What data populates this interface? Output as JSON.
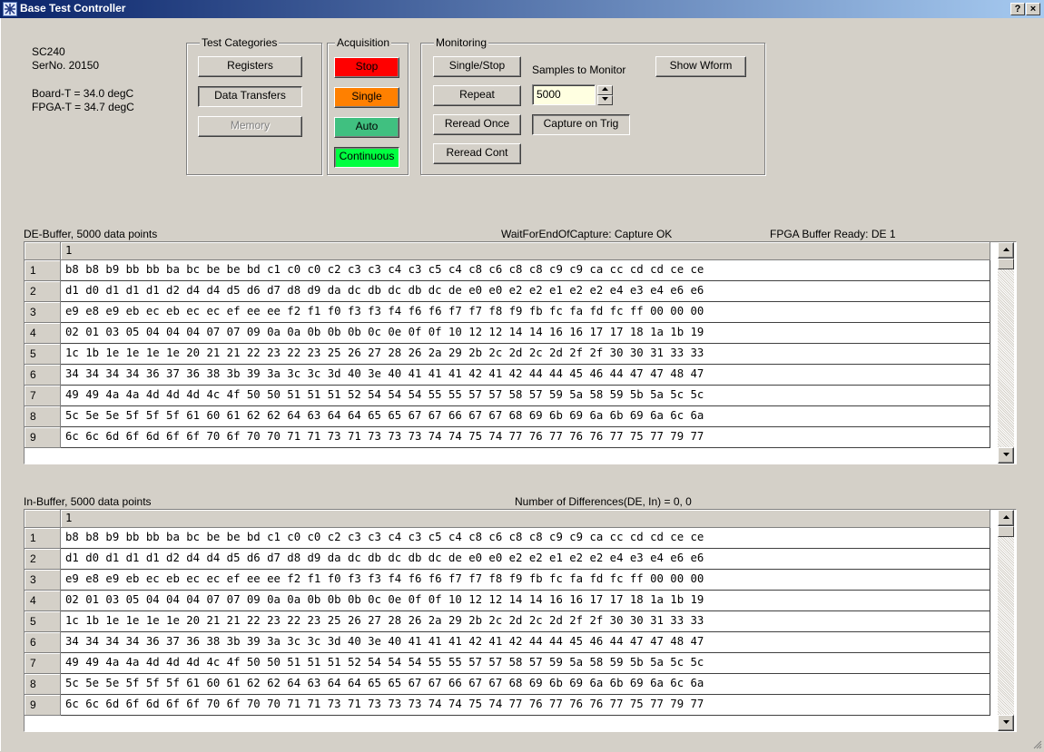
{
  "window": {
    "title": "Base Test Controller",
    "help_label": "?",
    "close_label": "×"
  },
  "device": {
    "model": "SC240",
    "serial": "SerNo. 20150",
    "board_temp": "Board-T = 34.0 degC",
    "fpga_temp": "FPGA-T = 34.7 degC"
  },
  "test_categories": {
    "label": "Test Categories",
    "registers": "Registers",
    "data_transfers": "Data Transfers",
    "memory": "Memory"
  },
  "acquisition": {
    "label": "Acquisition",
    "stop": "Stop",
    "single": "Single",
    "auto": "Auto",
    "continuous": "Continuous",
    "colors": {
      "stop": "#ff0000",
      "single": "#ff8000",
      "auto": "#40c080",
      "continuous": "#00ff40"
    }
  },
  "monitoring": {
    "label": "Monitoring",
    "single_stop": "Single/Stop",
    "repeat": "Repeat",
    "reread_once": "Reread Once",
    "reread_cont": "Reread Cont",
    "samples_label": "Samples to Monitor",
    "samples_value": "5000",
    "capture_on_trig": "Capture on Trig",
    "show_wform": "Show Wform"
  },
  "de_buffer": {
    "title": "DE-Buffer,  5000 data points",
    "status": "WaitForEndOfCapture: Capture OK",
    "fpga_status": "FPGA Buffer Ready:  DE 1",
    "col_header": "1",
    "rows": [
      {
        "n": "1",
        "v": "b8 b8 b9 bb bb ba bc be be bd c1 c0 c0 c2 c3 c3 c4 c3 c5 c4 c8 c6 c8 c8 c9 c9 ca cc cd cd ce ce"
      },
      {
        "n": "2",
        "v": "d1 d0 d1 d1 d1 d2 d4 d4 d5 d6 d7 d8 d9 da dc db dc db dc de e0 e0 e2 e2 e1 e2 e2 e4 e3 e4 e6 e6"
      },
      {
        "n": "3",
        "v": "e9 e8 e9 eb ec eb ec ec ef ee ee f2 f1 f0 f3 f3 f4 f6 f6 f7 f7 f8 f9 fb fc fa fd fc ff 00 00 00"
      },
      {
        "n": "4",
        "v": "02 01 03 05 04 04 04 07 07 09 0a 0a 0b 0b 0b 0c 0e 0f 0f 10 12 12 14 14 16 16 17 17 18 1a 1b 19"
      },
      {
        "n": "5",
        "v": "1c 1b 1e 1e 1e 1e 20 21 21 22 23 22 23 25 26 27 28 26 2a 29 2b 2c 2d 2c 2d 2f 2f 30 30 31 33 33"
      },
      {
        "n": "6",
        "v": "34 34 34 34 36 37 36 38 3b 39 3a 3c 3c 3d 40 3e 40 41 41 41 42 41 42 44 44 45 46 44 47 47 48 47"
      },
      {
        "n": "7",
        "v": "49 49 4a 4a 4d 4d 4d 4c 4f 50 50 51 51 51 52 54 54 54 55 55 57 57 58 57 59 5a 58 59 5b 5a 5c 5c"
      },
      {
        "n": "8",
        "v": "5c 5e 5e 5f 5f 5f 61 60 61 62 62 64 63 64 64 65 65 67 67 66 67 67 68 69 6b 69 6a 6b 69 6a 6c 6a"
      },
      {
        "n": "9",
        "v": "6c 6c 6d 6f 6d 6f 6f 70 6f 70 70 71 71 73 71 73 73 73 74 74 75 74 77 76 77 76 76 77 75 77 79 77"
      }
    ]
  },
  "in_buffer": {
    "title": "In-Buffer,  5000 data points",
    "status": "Number of Differences(DE, In) = 0, 0",
    "col_header": "1",
    "rows": [
      {
        "n": "1",
        "v": "b8 b8 b9 bb bb ba bc be be bd c1 c0 c0 c2 c3 c3 c4 c3 c5 c4 c8 c6 c8 c8 c9 c9 ca cc cd cd ce ce"
      },
      {
        "n": "2",
        "v": "d1 d0 d1 d1 d1 d2 d4 d4 d5 d6 d7 d8 d9 da dc db dc db dc de e0 e0 e2 e2 e1 e2 e2 e4 e3 e4 e6 e6"
      },
      {
        "n": "3",
        "v": "e9 e8 e9 eb ec eb ec ec ef ee ee f2 f1 f0 f3 f3 f4 f6 f6 f7 f7 f8 f9 fb fc fa fd fc ff 00 00 00"
      },
      {
        "n": "4",
        "v": "02 01 03 05 04 04 04 07 07 09 0a 0a 0b 0b 0b 0c 0e 0f 0f 10 12 12 14 14 16 16 17 17 18 1a 1b 19"
      },
      {
        "n": "5",
        "v": "1c 1b 1e 1e 1e 1e 20 21 21 22 23 22 23 25 26 27 28 26 2a 29 2b 2c 2d 2c 2d 2f 2f 30 30 31 33 33"
      },
      {
        "n": "6",
        "v": "34 34 34 34 36 37 36 38 3b 39 3a 3c 3c 3d 40 3e 40 41 41 41 42 41 42 44 44 45 46 44 47 47 48 47"
      },
      {
        "n": "7",
        "v": "49 49 4a 4a 4d 4d 4d 4c 4f 50 50 51 51 51 52 54 54 54 55 55 57 57 58 57 59 5a 58 59 5b 5a 5c 5c"
      },
      {
        "n": "8",
        "v": "5c 5e 5e 5f 5f 5f 61 60 61 62 62 64 63 64 64 65 65 67 67 66 67 67 68 69 6b 69 6a 6b 69 6a 6c 6a"
      },
      {
        "n": "9",
        "v": "6c 6c 6d 6f 6d 6f 6f 70 6f 70 70 71 71 73 71 73 73 73 74 74 75 74 77 76 77 76 76 77 75 77 79 77"
      }
    ]
  }
}
